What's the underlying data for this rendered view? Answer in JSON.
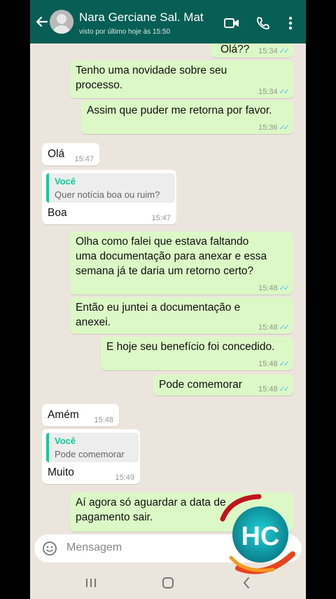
{
  "header": {
    "contact_name": "Nara Gerciane Sal. Mat",
    "last_seen": "visto por último hoje às 15:50"
  },
  "messages": [
    {
      "direction": "out",
      "text": "Olá??",
      "time": "15:34",
      "status": "read"
    },
    {
      "direction": "out",
      "text": "Tenho uma novidade sobre seu\nprocesso.",
      "time": "15:34",
      "status": "read"
    },
    {
      "direction": "out",
      "text": "Assim que puder me retorna por favor.",
      "time": "15:36",
      "status": "read"
    },
    {
      "direction": "in",
      "text": "Olá",
      "time": "15:47"
    },
    {
      "direction": "in",
      "quote": {
        "author": "Você",
        "text": "Quer notícia boa ou ruim?"
      },
      "text": "Boa",
      "time": "15:47"
    },
    {
      "direction": "out",
      "text": "Olha como falei que estava faltando\numa documentação para anexar e essa\nsemana já te daria um retorno certo?",
      "time": "15:48",
      "status": "read"
    },
    {
      "direction": "out",
      "text": "Então eu juntei a documentação e\nanexei.",
      "time": "15:48",
      "status": "read"
    },
    {
      "direction": "out",
      "text": "E hoje seu benefício foi concedido.",
      "time": "15:48",
      "status": "read"
    },
    {
      "direction": "out",
      "text": "Pode comemorar",
      "time": "15:48",
      "status": "read"
    },
    {
      "direction": "in",
      "text": "Amém",
      "time": "15:48"
    },
    {
      "direction": "in",
      "quote": {
        "author": "Você",
        "text": "Pode comemorar"
      },
      "text": "Muito",
      "time": "15:49"
    },
    {
      "direction": "out",
      "text": "Aí agora só aguardar a data de\npagamento sair.",
      "time": "",
      "status": "read"
    }
  ],
  "composer": {
    "placeholder": "Mensagem"
  },
  "logo": {
    "text": "HC"
  },
  "colors": {
    "header": "#075e54",
    "outgoing": "#dcf8c6",
    "incoming": "#ffffff",
    "chat_bg": "#ece5dd",
    "read_ticks": "#4fc3f7",
    "quote_accent": "#06cf9c"
  },
  "icons": [
    "back-arrow-icon",
    "video-call-icon",
    "phone-icon",
    "more-vert-icon",
    "emoji-icon",
    "attach-icon",
    "nav-recents-icon",
    "nav-home-icon",
    "nav-back-icon"
  ]
}
